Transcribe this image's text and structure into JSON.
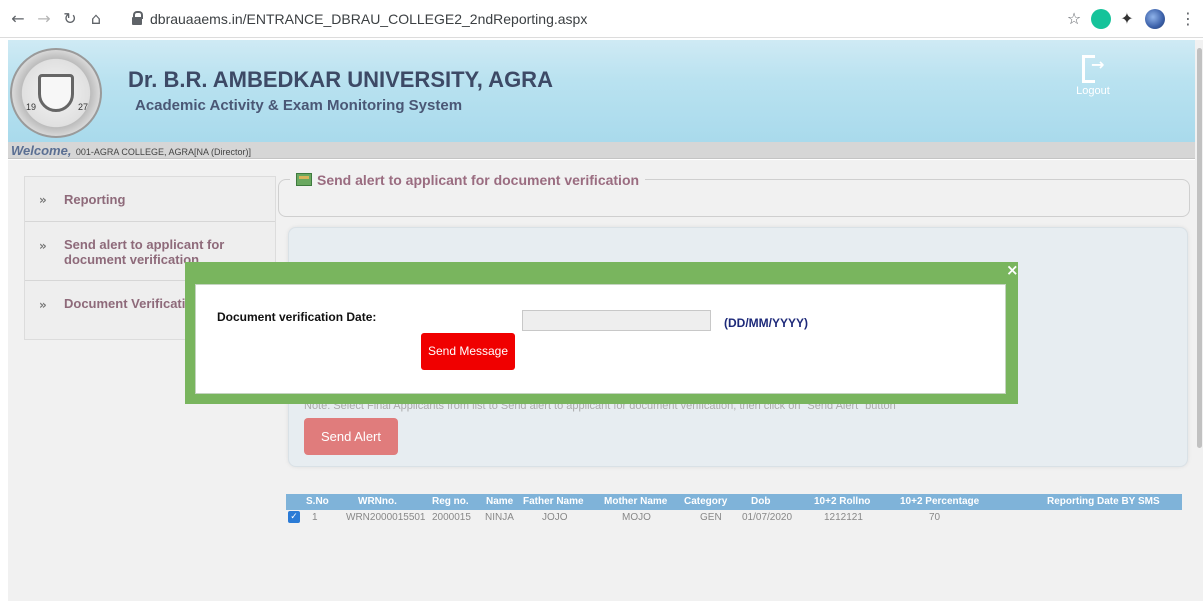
{
  "browser": {
    "url": "dbrauaaems.in/ENTRANCE_DBRAU_COLLEGE2_2ndReporting.aspx"
  },
  "header": {
    "university": "Dr. B.R. AMBEDKAR UNIVERSITY, AGRA",
    "system": "Academic Activity & Exam Monitoring System",
    "logo_year_left": "19",
    "logo_year_right": "27",
    "logout_label": "Logout"
  },
  "welcome": {
    "word": "Welcome,",
    "text": "001-AGRA COLLEGE, AGRA[NA (Director)]"
  },
  "sidebar": {
    "items": [
      {
        "label": "Reporting"
      },
      {
        "label": "Send alert to applicant for document verification"
      },
      {
        "label": "Document Verification Admit"
      }
    ]
  },
  "section": {
    "title": "Send alert to applicant for document verification"
  },
  "panel": {
    "note": "Note: Select Final Applicants from list to Send alert to applicant for document verification, then click on \"Send Alert\" button",
    "send_alert_label": "Send Alert"
  },
  "table": {
    "headers": [
      "S.No",
      "WRNno.",
      "Reg no.",
      "Name",
      "Father Name",
      "Mother Name",
      "Category",
      "Dob",
      "10+2 Rollno",
      "10+2 Percentage",
      "Reporting Date BY SMS"
    ],
    "rows": [
      {
        "checked": true,
        "sno": "1",
        "wrn": "WRN2000015501",
        "reg": "2000015",
        "name": "NINJA",
        "father": "JOJO",
        "mother": "MOJO",
        "category": "GEN",
        "dob": "01/07/2020",
        "rollno": "1212121",
        "percentage": "70",
        "reporting": ""
      }
    ]
  },
  "modal": {
    "date_label": "Document verification Date:",
    "date_value": "",
    "date_format": "(DD/MM/YYYY)",
    "send_message_label": "Send Message",
    "close_glyph": "×"
  },
  "colors": {
    "header_bg": "#b9e2f0",
    "modal_border": "#79b55e",
    "send_message_bg": "#f00000",
    "send_alert_bg": "#e07c7c",
    "table_header_bg": "#7fb3d9"
  }
}
